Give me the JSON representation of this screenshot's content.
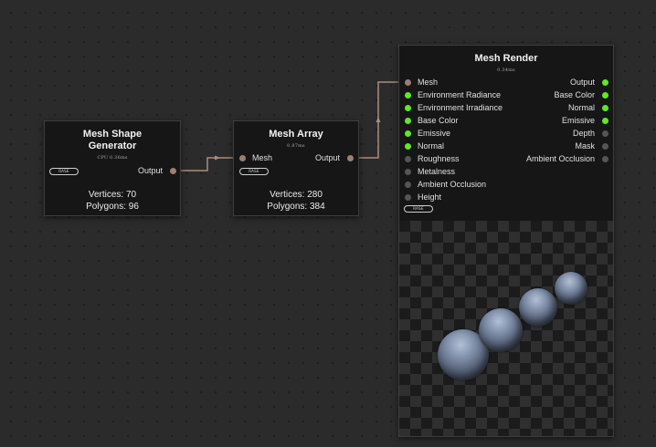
{
  "nodes": {
    "shape_gen": {
      "title": "Mesh Shape Generator",
      "timing": "CPU 0.36ms",
      "badge": "RASE",
      "output_label": "Output",
      "vertices": "Vertices: 70",
      "polygons": "Polygons: 96"
    },
    "array": {
      "title": "Mesh Array",
      "timing": "0.87ms",
      "badge": "RASE",
      "input_label": "Mesh",
      "output_label": "Output",
      "vertices": "Vertices: 280",
      "polygons": "Polygons: 384"
    },
    "render": {
      "title": "Mesh Render",
      "timing": "0.34ms",
      "badge": "RASE",
      "inputs": [
        {
          "label": "Mesh",
          "state": "mesh"
        },
        {
          "label": "Environment Radiance",
          "state": "on"
        },
        {
          "label": "Environment Irradiance",
          "state": "on"
        },
        {
          "label": "Base Color",
          "state": "on"
        },
        {
          "label": "Emissive",
          "state": "on"
        },
        {
          "label": "Normal",
          "state": "on"
        },
        {
          "label": "Roughness",
          "state": "off"
        },
        {
          "label": "Metalness",
          "state": "off"
        },
        {
          "label": "Ambient Occlusion",
          "state": "off"
        },
        {
          "label": "Height",
          "state": "off"
        }
      ],
      "outputs": [
        {
          "label": "Output",
          "state": "on"
        },
        {
          "label": "Base Color",
          "state": "on"
        },
        {
          "label": "Normal",
          "state": "on"
        },
        {
          "label": "Emissive",
          "state": "on"
        },
        {
          "label": "Depth",
          "state": "off"
        },
        {
          "label": "Mask",
          "state": "off"
        },
        {
          "label": "Ambient Occlusion",
          "state": "off"
        }
      ]
    }
  },
  "colors": {
    "active_port": "#5ee825",
    "inactive_port": "#555555",
    "mesh_port": "#9b7f73",
    "wire": "#ad8c80"
  }
}
